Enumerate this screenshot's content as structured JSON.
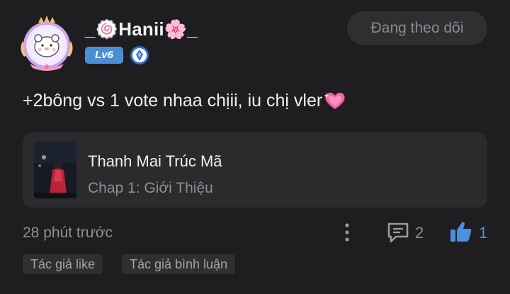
{
  "user": {
    "name": "_🍥Hanii🌸_",
    "level": "Lv6"
  },
  "follow_button": {
    "label": "Đang theo dõi"
  },
  "comment": {
    "text": "+2bông vs 1 vote nhaa chịii, iu chị vler"
  },
  "story": {
    "title": "Thanh Mai Trúc Mã",
    "chapter": "Chap 1: Giới Thiệu"
  },
  "footer": {
    "timestamp": "28 phút trước",
    "reply_count": "2",
    "like_count": "1"
  },
  "tags": [
    "Tác giả like",
    "Tác giả bình luận"
  ],
  "colors": {
    "background": "#1e1e20",
    "card": "#2b2b2e",
    "level_badge": "#4a8fd6",
    "like_accent": "#4a90e2",
    "muted_text": "#8e8e93"
  },
  "icons": [
    "avatar-frame",
    "diamond-rank-icon",
    "sparkling-heart-icon",
    "more-vertical-icon",
    "comment-icon",
    "thumbs-up-icon"
  ]
}
